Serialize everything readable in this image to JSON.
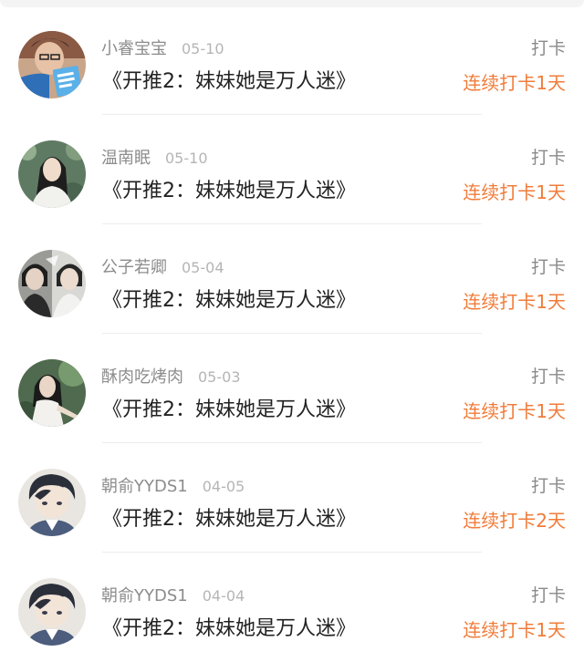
{
  "items": [
    {
      "username": "小睿宝宝",
      "date": "05-10",
      "title": "《开推2：妹妹她是万人迷》",
      "checkin": "打卡",
      "streak": "连续打卡1天",
      "avatar": "avatar-1"
    },
    {
      "username": "温南眠",
      "date": "05-10",
      "title": "《开推2：妹妹她是万人迷》",
      "checkin": "打卡",
      "streak": "连续打卡1天",
      "avatar": "avatar-2"
    },
    {
      "username": "公子若卿",
      "date": "05-04",
      "title": "《开推2：妹妹她是万人迷》",
      "checkin": "打卡",
      "streak": "连续打卡1天",
      "avatar": "avatar-3"
    },
    {
      "username": "酥肉吃烤肉",
      "date": "05-03",
      "title": "《开推2：妹妹她是万人迷》",
      "checkin": "打卡",
      "streak": "连续打卡1天",
      "avatar": "avatar-4"
    },
    {
      "username": "朝俞YYDS1",
      "date": "04-05",
      "title": "《开推2：妹妹她是万人迷》",
      "checkin": "打卡",
      "streak": "连续打卡2天",
      "avatar": "avatar-5"
    },
    {
      "username": "朝俞YYDS1",
      "date": "04-04",
      "title": "《开推2：妹妹她是万人迷》",
      "checkin": "打卡",
      "streak": "连续打卡1天",
      "avatar": "avatar-6"
    }
  ],
  "colors": {
    "accent": "#f07c3a",
    "username": "#8c8c8c",
    "date": "#b5b5b5",
    "title": "#222222",
    "divider": "#ececec"
  }
}
